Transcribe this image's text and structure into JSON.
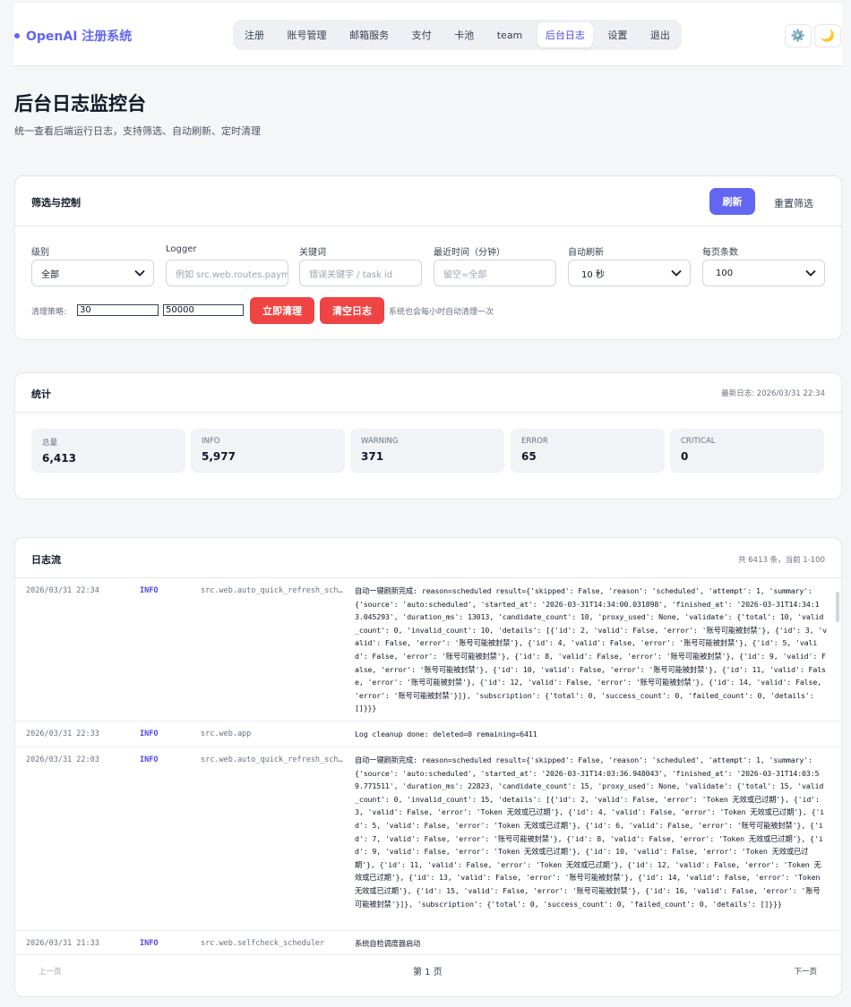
{
  "header": {
    "logo": "OpenAI 注册系统",
    "nav": [
      "注册",
      "账号管理",
      "邮箱服务",
      "支付",
      "卡池",
      "team",
      "后台日志",
      "设置",
      "退出"
    ],
    "active_nav": "后台日志",
    "settings_icon": "⚙️",
    "theme_icon": "🌙"
  },
  "page": {
    "title": "后台日志监控台",
    "subtitle": "统一查看后端运行日志，支持筛选、自动刷新、定时清理"
  },
  "filters": {
    "title": "筛选与控制",
    "refresh_label": "刷新",
    "reset_label": "重置筛选",
    "level_label": "级别",
    "level_value": "全部",
    "logger_label": "Logger",
    "logger_placeholder": "例如 src.web.routes.payment",
    "keyword_label": "关键词",
    "keyword_placeholder": "错误关键字 / task id",
    "minutes_label": "最近时间（分钟）",
    "minutes_placeholder": "留空=全部",
    "auto_label": "自动刷新",
    "auto_value": "10 秒",
    "pagesize_label": "每页条数",
    "pagesize_value": "100",
    "cleanup_label": "清理策略:",
    "cleanup_days": "30",
    "cleanup_max": "50000",
    "cleanup_now_label": "立即清理",
    "clear_logs_label": "清空日志",
    "cleanup_note": "系统也会每小时自动清理一次"
  },
  "stats": {
    "title": "统计",
    "latest": "最新日志: 2026/03/31 22:34",
    "items": [
      {
        "label": "总量",
        "value": "6,413"
      },
      {
        "label": "INFO",
        "value": "5,977"
      },
      {
        "label": "WARNING",
        "value": "371"
      },
      {
        "label": "ERROR",
        "value": "65"
      },
      {
        "label": "CRITICAL",
        "value": "0"
      }
    ]
  },
  "logs": {
    "title": "日志流",
    "summary": "共 6413 条，当前 1-100",
    "rows": [
      {
        "time": "2026/03/31 22:34",
        "level": "INFO",
        "logger": "src.web.auto_quick_refresh_scheduler",
        "message": "自动一键刷新完成: reason=scheduled result={'skipped': False, 'reason': 'scheduled', 'attempt': 1, 'summary': {'source': 'auto:scheduled', 'started_at': '2026-03-31T14:34:00.031898', 'finished_at': '2026-03-31T14:34:13.045293', 'duration_ms': 13013, 'candidate_count': 10, 'proxy_used': None, 'validate': {'total': 10, 'valid_count': 0, 'invalid_count': 10, 'details': [{'id': 2, 'valid': False, 'error': '账号可能被封禁'}, {'id': 3, 'valid': False, 'error': '账号可能被封禁'}, {'id': 4, 'valid': False, 'error': '账号可能被封禁'}, {'id': 5, 'valid': False, 'error': '账号可能被封禁'}, {'id': 8, 'valid': False, 'error': '账号可能被封禁'}, {'id': 9, 'valid': False, 'error': '账号可能被封禁'}, {'id': 10, 'valid': False, 'error': '账号可能被封禁'}, {'id': 11, 'valid': False, 'error': '账号可能被封禁'}, {'id': 12, 'valid': False, 'error': '账号可能被封禁'}, {'id': 14, 'valid': False, 'error': '账号可能被封禁'}]}, 'subscription': {'total': 0, 'success_count': 0, 'failed_count': 0, 'details': []}}}"
      },
      {
        "time": "2026/03/31 22:33",
        "level": "INFO",
        "logger": "src.web.app",
        "message": "Log cleanup done: deleted=0 remaining=6411"
      },
      {
        "time": "2026/03/31 22:03",
        "level": "INFO",
        "logger": "src.web.auto_quick_refresh_scheduler",
        "message": "自动一键刷新完成: reason=scheduled result={'skipped': False, 'reason': 'scheduled', 'attempt': 1, 'summary': {'source': 'auto:scheduled', 'started_at': '2026-03-31T14:03:36.948043', 'finished_at': '2026-03-31T14:03:59.771511', 'duration_ms': 22823, 'candidate_count': 15, 'proxy_used': None, 'validate': {'total': 15, 'valid_count': 0, 'invalid_count': 15, 'details': [{'id': 2, 'valid': False, 'error': 'Token 无效或已过期'}, {'id': 3, 'valid': False, 'error': 'Token 无效或已过期'}, {'id': 4, 'valid': False, 'error': 'Token 无效或已过期'}, {'id': 5, 'valid': False, 'error': 'Token 无效或已过期'}, {'id': 6, 'valid': False, 'error': '账号可能被封禁'}, {'id': 7, 'valid': False, 'error': '账号可能被封禁'}, {'id': 8, 'valid': False, 'error': 'Token 无效或已过期'}, {'id': 9, 'valid': False, 'error': 'Token 无效或已过期'}, {'id': 10, 'valid': False, 'error': 'Token 无效或已过期'}, {'id': 11, 'valid': False, 'error': 'Token 无效或已过期'}, {'id': 12, 'valid': False, 'error': 'Token 无效或已过期'}, {'id': 13, 'valid': False, 'error': '账号可能被封禁'}, {'id': 14, 'valid': False, 'error': 'Token 无效或已过期'}, {'id': 15, 'valid': False, 'error': '账号可能被封禁'}, {'id': 16, 'valid': False, 'error': '账号可能被封禁'}]}, 'subscription': {'total': 0, 'success_count': 0, 'failed_count': 0, 'details': []}}}"
      },
      {
        "time": "2026/03/31 21:33",
        "level": "INFO",
        "logger": "src.web.selfcheck_scheduler",
        "message": "系统自检调度器启动"
      }
    ]
  },
  "pager": {
    "prev": "上一页",
    "current": "第 1 页",
    "next": "下一页"
  }
}
